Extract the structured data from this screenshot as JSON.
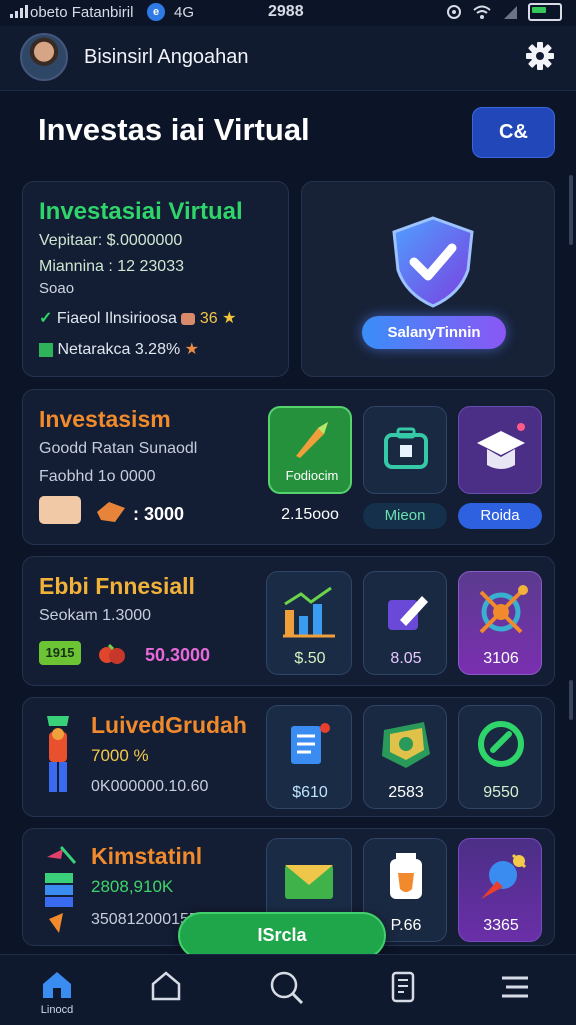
{
  "status_bar": {
    "carrier": "obeto Fatanbiril",
    "network": "4G",
    "time": "2988"
  },
  "header": {
    "username": "Bisinsirl Angoahan"
  },
  "page": {
    "title": "Investas iai Virtual",
    "top_button_label": "C&"
  },
  "summary_card": {
    "title": "Investasiai Virtual",
    "line1": "Vepitaar: $.0000000",
    "line2": "Miannina : 12 23033",
    "line3": "Soao",
    "line4": "Fiaeol Ilnsirioosa",
    "line4_value": "36",
    "line5": "Netarakca 3.28%",
    "saving_button": "SalanyTinnin"
  },
  "investasi_card": {
    "title": "Investasism",
    "line1": "Goodd Ratan Sunaodl",
    "line2": "Faobhd 1o 0000",
    "amount": ": 3000",
    "tiles": [
      {
        "name": "Fodiocim",
        "value": "2.15ooo"
      },
      {
        "name": "",
        "value": "Mieon"
      },
      {
        "name": "",
        "value": "Roida"
      }
    ]
  },
  "finansial_card": {
    "title": "Ebbi Fnnesiall",
    "line1": "Seokam 1.3000",
    "badge": "1915",
    "amount": "50.3000",
    "tiles": [
      {
        "value": "$.50"
      },
      {
        "value": "8.05"
      },
      {
        "value": "3106"
      }
    ]
  },
  "luvert_card": {
    "title": "LuivedGrudah",
    "line1": "7000 %",
    "line2": "0K000000.10.60",
    "tiles": [
      {
        "value": "$610"
      },
      {
        "value": "2583"
      },
      {
        "value": "9550"
      }
    ]
  },
  "kimstatinl_card": {
    "title": "Kimstatinl",
    "line1": "2808,910K",
    "line2": "3508120001550",
    "tiles": [
      {
        "value": ""
      },
      {
        "value": "P.66"
      },
      {
        "value": "3365"
      }
    ]
  },
  "fab": {
    "label": "ISrcla"
  },
  "bottom_nav": {
    "home_label": "Linocd"
  },
  "icons": {
    "gear": "gear-icon",
    "shield": "shield-check-icon",
    "home": "home-icon",
    "house": "house-outline-icon",
    "search": "search-icon",
    "chip": "chip-icon",
    "menu": "menu-icon"
  },
  "colors": {
    "accent_green": "#2fd46b",
    "accent_blue": "#2247b8",
    "orange": "#f08a2c"
  }
}
